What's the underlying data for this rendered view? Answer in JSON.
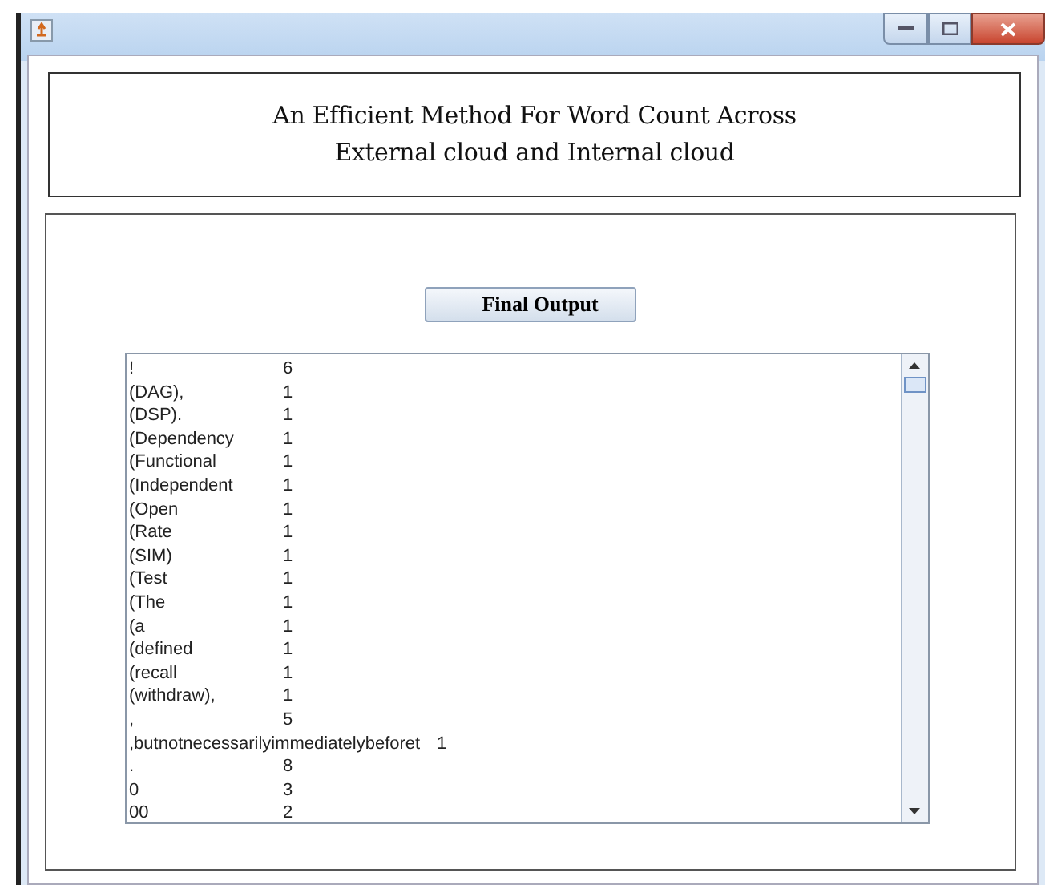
{
  "header": {
    "title_lines": [
      "An Efficient Method For Word Count Across",
      "External cloud and Internal cloud"
    ]
  },
  "button": {
    "label": "Final Output"
  },
  "output": {
    "rows": [
      {
        "word": "!",
        "count": "6"
      },
      {
        "word": "(DAG),",
        "count": "1"
      },
      {
        "word": "(DSP).",
        "count": "1"
      },
      {
        "word": "(Dependency",
        "count": "1"
      },
      {
        "word": "(Functional",
        "count": "1"
      },
      {
        "word": "(Independent",
        "count": "1"
      },
      {
        "word": "(Open",
        "count": "1"
      },
      {
        "word": "(Rate",
        "count": "1"
      },
      {
        "word": "(SIM)",
        "count": "1"
      },
      {
        "word": "(Test",
        "count": "1"
      },
      {
        "word": "(The",
        "count": "1"
      },
      {
        "word": "(a",
        "count": "1"
      },
      {
        "word": "(defined",
        "count": "1"
      },
      {
        "word": "(recall",
        "count": "1"
      },
      {
        "word": "(withdraw),",
        "count": "1"
      },
      {
        "word": ",",
        "count": "5"
      },
      {
        "word": ",butnotnecessarilyimmediatelybeforet",
        "count": "1"
      },
      {
        "word": ".",
        "count": "8"
      },
      {
        "word": "0",
        "count": "3"
      },
      {
        "word": "00",
        "count": "2"
      }
    ]
  }
}
